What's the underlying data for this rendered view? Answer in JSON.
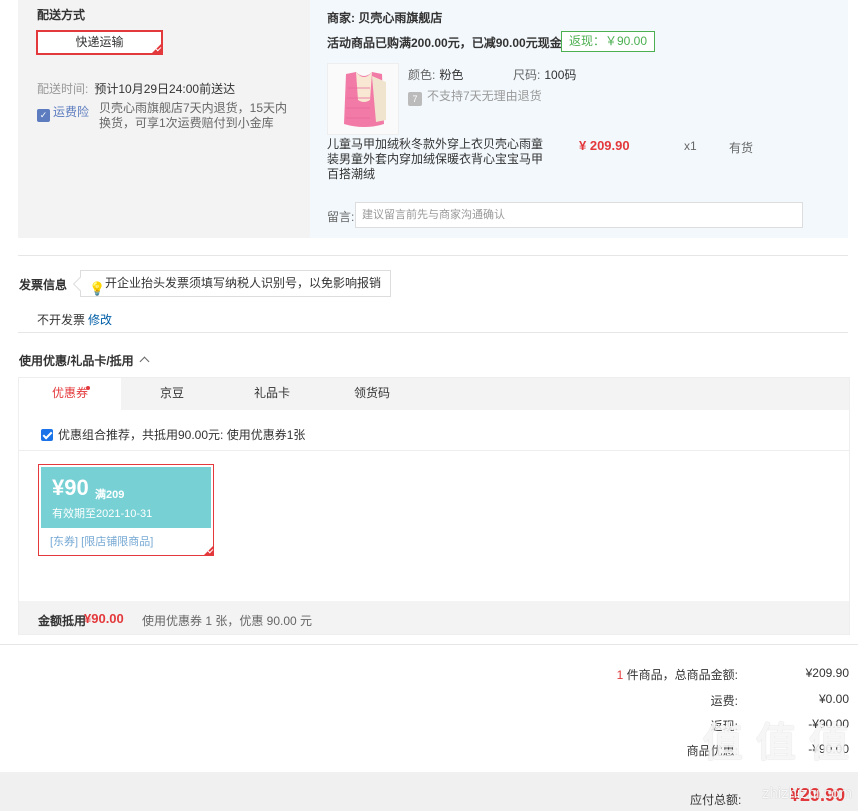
{
  "shipping": {
    "title": "配送方式",
    "method_button": "快递运输",
    "delivery_label": "配送时间:",
    "delivery_value": "预计10月29日24:00前送达",
    "insurance_badge": "运费险",
    "insurance_text": "贝壳心雨旗舰店7天内退货，15天内换货，可享1次运费赔付到小金库"
  },
  "shop": {
    "name": "商家: 贝壳心雨旗舰店",
    "promo": "活动商品已购满200.00元，已减90.00元现金",
    "rebate": "返现：￥90.00",
    "color_label": "颜色:",
    "color_value": "粉色",
    "size_label": "尺码:",
    "size_value": "100码",
    "no_return": "不支持7天无理由退货",
    "product_name": "儿童马甲加绒秋冬款外穿上衣贝壳心雨童装男童外套内穿加绒保暖衣背心宝宝马甲百搭潮绒",
    "price": "¥ 209.90",
    "qty": "x1",
    "stock": "有货",
    "message_label": "留言:",
    "message_placeholder": "建议留言前先与商家沟通确认"
  },
  "invoice": {
    "title": "发票信息",
    "tip": "开企业抬头发票须填写纳税人识别号，以免影响报销",
    "value": "不开发票",
    "edit_link": "修改"
  },
  "coupons": {
    "title": "使用优惠/礼品卡/抵用",
    "tabs": [
      {
        "label": "优惠券"
      },
      {
        "label": "京豆"
      },
      {
        "label": "礼品卡"
      },
      {
        "label": "领货码"
      }
    ],
    "recommend_text": "优惠组合推荐，共抵用90.00元: 使用优惠券1张",
    "card": {
      "amount": "¥90",
      "condition": "满209",
      "expiry": "有效期至2021-10-31",
      "tags": "[东券]  [限店铺限商品]"
    },
    "summary_label": "金额抵用",
    "summary_value": "¥90.00",
    "summary_note": "使用优惠券 1 张，优惠 90.00 元"
  },
  "totals": {
    "item_count": "1",
    "items_label": "件商品，总商品金额:",
    "items_value": "¥209.90",
    "shipping_label": "运费:",
    "shipping_value": "¥0.00",
    "rebate_label": "返现:",
    "rebate_value": "-¥90.00",
    "discount_label": "商品优惠:",
    "discount_value": "-¥90.00",
    "pay_label": "应付总额:",
    "pay_value": "¥29.90"
  },
  "watermark": {
    "text": "值 值 值",
    "url": "zhizhizhi.com"
  }
}
